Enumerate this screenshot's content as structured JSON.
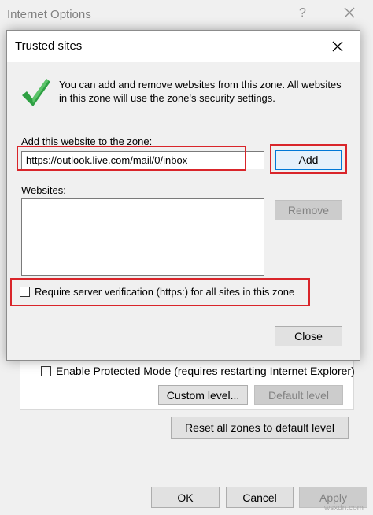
{
  "io_window": {
    "title": "Internet Options",
    "help_glyph": "?",
    "protected_mode_label": "Enable Protected Mode (requires restarting Internet Explorer)",
    "custom_level_label": "Custom level...",
    "default_level_label": "Default level",
    "reset_all_label": "Reset all zones to default level",
    "ok_label": "OK",
    "cancel_label": "Cancel",
    "apply_label": "Apply"
  },
  "dialog": {
    "title": "Trusted sites",
    "info_text": "You can add and remove websites from this zone. All websites in this zone will use the zone's security settings.",
    "add_website_label": "Add this website to the zone:",
    "url_value": "https://outlook.live.com/mail/0/inbox",
    "add_button": "Add",
    "websites_label": "Websites:",
    "websites": [],
    "remove_button": "Remove",
    "verify_label": "Require server verification (https:) for all sites in this zone",
    "verify_checked": false,
    "close_button": "Close"
  },
  "watermark": "wsxdn.com",
  "colors": {
    "highlight": "#d9252a",
    "check_green": "#2ea043",
    "focus_blue": "#0078d7"
  }
}
